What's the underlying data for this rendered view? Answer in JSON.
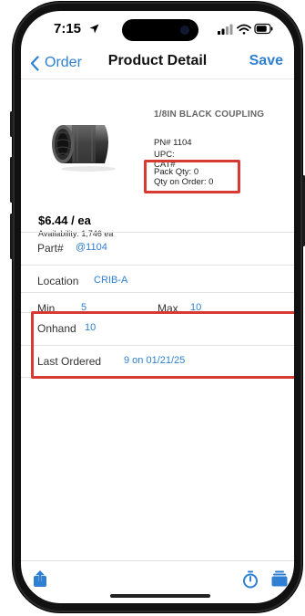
{
  "status_bar": {
    "time": "7:15"
  },
  "nav": {
    "back_label": "Order",
    "title": "Product Detail",
    "save_label": "Save"
  },
  "product": {
    "name": "1/8IN BLACK COUPLING",
    "pn": "PN# 1104",
    "upc": "UPC:",
    "cat": "CAT#",
    "pack_qty": "Pack Qty: 0",
    "qty_on_order": "Qty on Order: 0",
    "price": "$6.44 / ea",
    "availability": "Availability: 1,746 ea"
  },
  "fields": {
    "part_label": "Part#",
    "part_value": "@1104",
    "location_label": "Location",
    "location_value": "CRIB-A",
    "min_label": "Min",
    "min_value": "5",
    "max_label": "Max",
    "max_value": "10",
    "onhand_label": "Onhand",
    "onhand_value": "10",
    "last_ordered_label": "Last Ordered",
    "last_ordered_value": "9 on 01/21/25"
  },
  "toolbar": {
    "icons": [
      "share-icon",
      "timer-icon",
      "stack-icon"
    ]
  },
  "colors": {
    "accent": "#2f7fd2",
    "highlight": "#d63a32"
  }
}
